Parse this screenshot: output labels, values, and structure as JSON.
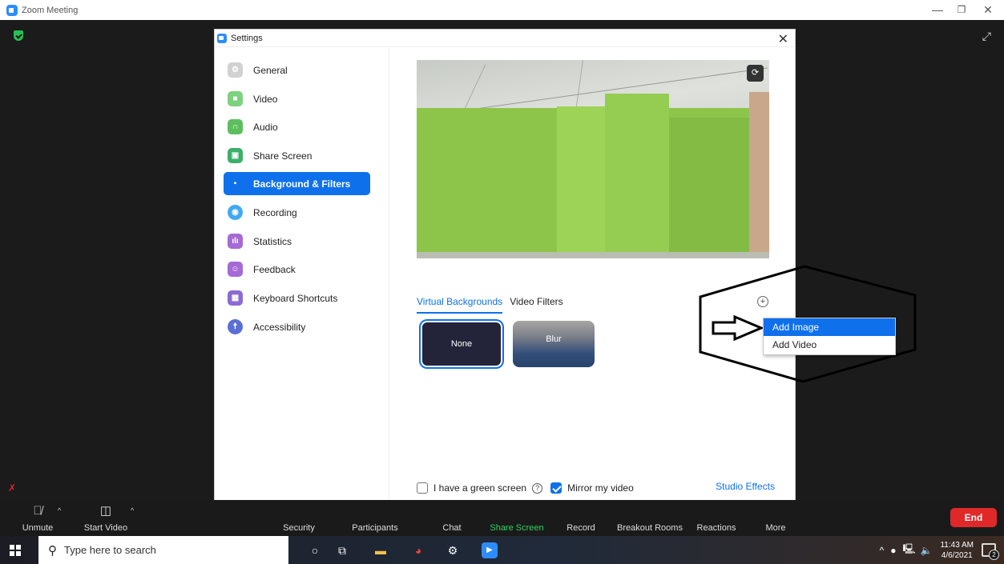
{
  "window": {
    "title": "Zoom Meeting",
    "minimize": "—",
    "restore": "❐",
    "close": "✕"
  },
  "settings": {
    "title": "Settings",
    "close": "✕",
    "nav": [
      {
        "label": "General",
        "icon": "gear-icon",
        "color": "#d1d1d1"
      },
      {
        "label": "Video",
        "icon": "video-icon",
        "color": "#7ed17e"
      },
      {
        "label": "Audio",
        "icon": "headphones-icon",
        "color": "#5cbf5c"
      },
      {
        "label": "Share Screen",
        "icon": "share-screen-icon",
        "color": "#3caf6a"
      },
      {
        "label": "Background & Filters",
        "icon": "background-icon",
        "color": "#0e71eb"
      },
      {
        "label": "Recording",
        "icon": "recording-icon",
        "color": "#3fa9f5"
      },
      {
        "label": "Statistics",
        "icon": "statistics-icon",
        "color": "#a56ad6"
      },
      {
        "label": "Feedback",
        "icon": "feedback-icon",
        "color": "#a56ad6"
      },
      {
        "label": "Keyboard Shortcuts",
        "icon": "keyboard-icon",
        "color": "#8a6ad6"
      },
      {
        "label": "Accessibility",
        "icon": "accessibility-icon",
        "color": "#5b6fd6"
      }
    ],
    "tabs": [
      "Virtual Backgrounds",
      "Video Filters"
    ],
    "backgrounds": [
      "None",
      "Blur"
    ],
    "menu": [
      "Add Image",
      "Add Video"
    ],
    "green_screen": "I have a green screen",
    "mirror": "Mirror my video",
    "studio": "Studio Effects"
  },
  "toolbar": {
    "unmute": "Unmute",
    "start_video": "Start Video",
    "security": "Security",
    "participants": "Participants",
    "chat": "Chat",
    "share_screen": "Share Screen",
    "record": "Record",
    "breakout": "Breakout Rooms",
    "reactions": "Reactions",
    "more": "More",
    "end": "End"
  },
  "taskbar": {
    "search_placeholder": "Type here to search",
    "time": "11:43 AM",
    "date": "4/6/2021",
    "notifications": "2"
  },
  "colors": {
    "accent": "#0e71eb",
    "end": "#e02828",
    "share_green": "#23d959"
  }
}
